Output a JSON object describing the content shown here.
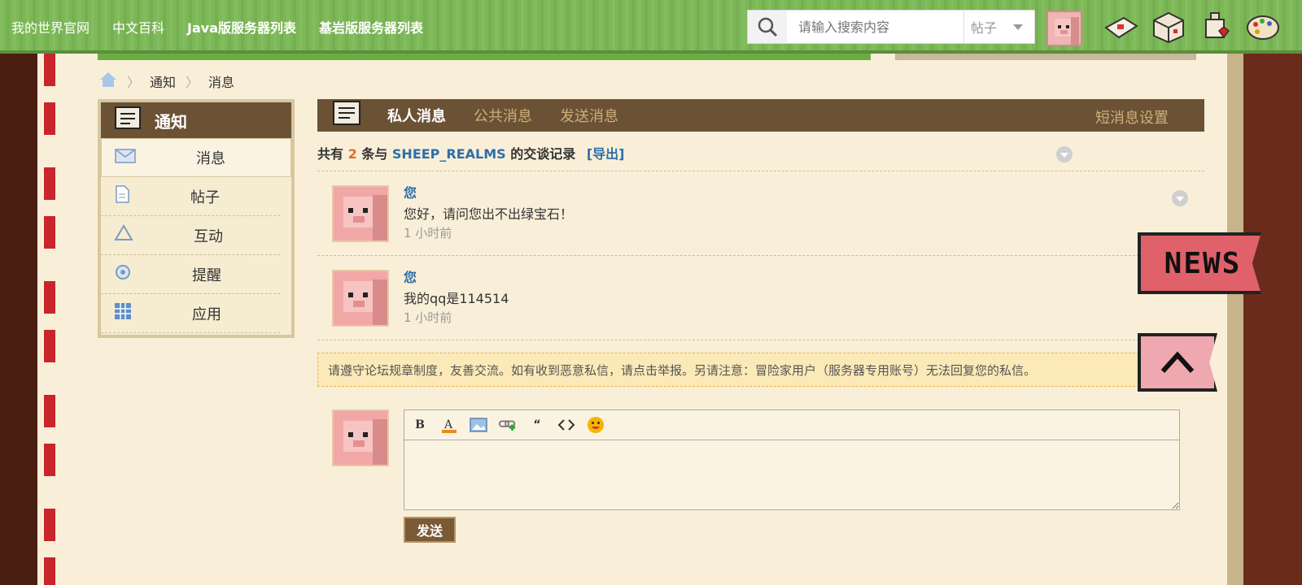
{
  "topnav": {
    "items": [
      "我的世界官网",
      "中文百科",
      "Java版服务器列表",
      "基岩版服务器列表"
    ],
    "search_placeholder": "请输入搜索内容",
    "search_scope": "帖子"
  },
  "breadcrumb": {
    "items": [
      "通知",
      "消息"
    ]
  },
  "sidebar": {
    "title": "通知",
    "items": [
      "消息",
      "帖子",
      "互动",
      "提醒",
      "应用"
    ]
  },
  "tabs": {
    "items": [
      "私人消息",
      "公共消息",
      "发送消息"
    ],
    "settings": "短消息设置"
  },
  "summary": {
    "prefix": "共有",
    "count": "2",
    "middle": "条与",
    "user": "SHEEP_REALMS",
    "suffix": "的交谈记录",
    "export": "[导出]"
  },
  "messages": [
    {
      "author": "您",
      "text": "您好，请问您出不出绿宝石！",
      "time": "1 小时前"
    },
    {
      "author": "您",
      "text": "我的qq是114514",
      "time": "1 小时前"
    }
  ],
  "notice": "请遵守论坛规章制度，友善交流。如有收到恶意私信，请点击举报。另请注意：冒险家用户（服务器专用账号）无法回复您的私信。",
  "editor": {
    "send_label": "发送"
  },
  "badges": {
    "news": "NEWS"
  }
}
